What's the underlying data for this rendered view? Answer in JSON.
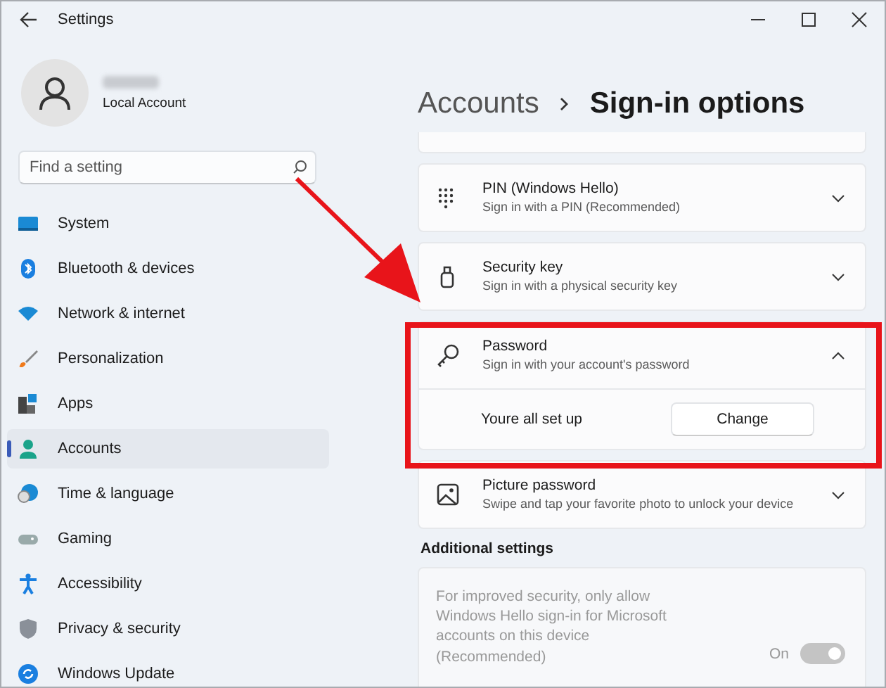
{
  "window": {
    "title": "Settings"
  },
  "profile": {
    "account_type": "Local Account"
  },
  "search": {
    "placeholder": "Find a setting"
  },
  "nav": [
    {
      "kind": "system",
      "label": "System",
      "selected": false
    },
    {
      "kind": "bluetooth",
      "label": "Bluetooth & devices",
      "selected": false
    },
    {
      "kind": "network",
      "label": "Network & internet",
      "selected": false
    },
    {
      "kind": "personalization",
      "label": "Personalization",
      "selected": false
    },
    {
      "kind": "apps",
      "label": "Apps",
      "selected": false
    },
    {
      "kind": "accounts",
      "label": "Accounts",
      "selected": true
    },
    {
      "kind": "time",
      "label": "Time & language",
      "selected": false
    },
    {
      "kind": "gaming",
      "label": "Gaming",
      "selected": false
    },
    {
      "kind": "accessibility",
      "label": "Accessibility",
      "selected": false
    },
    {
      "kind": "privacy",
      "label": "Privacy & security",
      "selected": false
    },
    {
      "kind": "update",
      "label": "Windows Update",
      "selected": false
    }
  ],
  "breadcrumb": {
    "parent": "Accounts",
    "current": "Sign-in options"
  },
  "options": [
    {
      "kind": "pin",
      "title": "PIN (Windows Hello)",
      "subtitle": "Sign in with a PIN (Recommended)",
      "expanded": false
    },
    {
      "kind": "key",
      "title": "Security key",
      "subtitle": "Sign in with a physical security key",
      "expanded": false
    },
    {
      "kind": "password",
      "title": "Password",
      "subtitle": "Sign in with your account's password",
      "expanded": true,
      "detail": {
        "status": "Youre all set up",
        "button": "Change"
      }
    },
    {
      "kind": "picture",
      "title": "Picture password",
      "subtitle": "Swipe and tap your favorite photo to unlock your device",
      "expanded": false
    }
  ],
  "additional": {
    "heading": "Additional settings",
    "settings": [
      {
        "text": "For improved security, only allow Windows Hello sign-in for Microsoft accounts on this device (Recommended)",
        "state_label": "On",
        "on": true,
        "disabled": true
      }
    ]
  }
}
